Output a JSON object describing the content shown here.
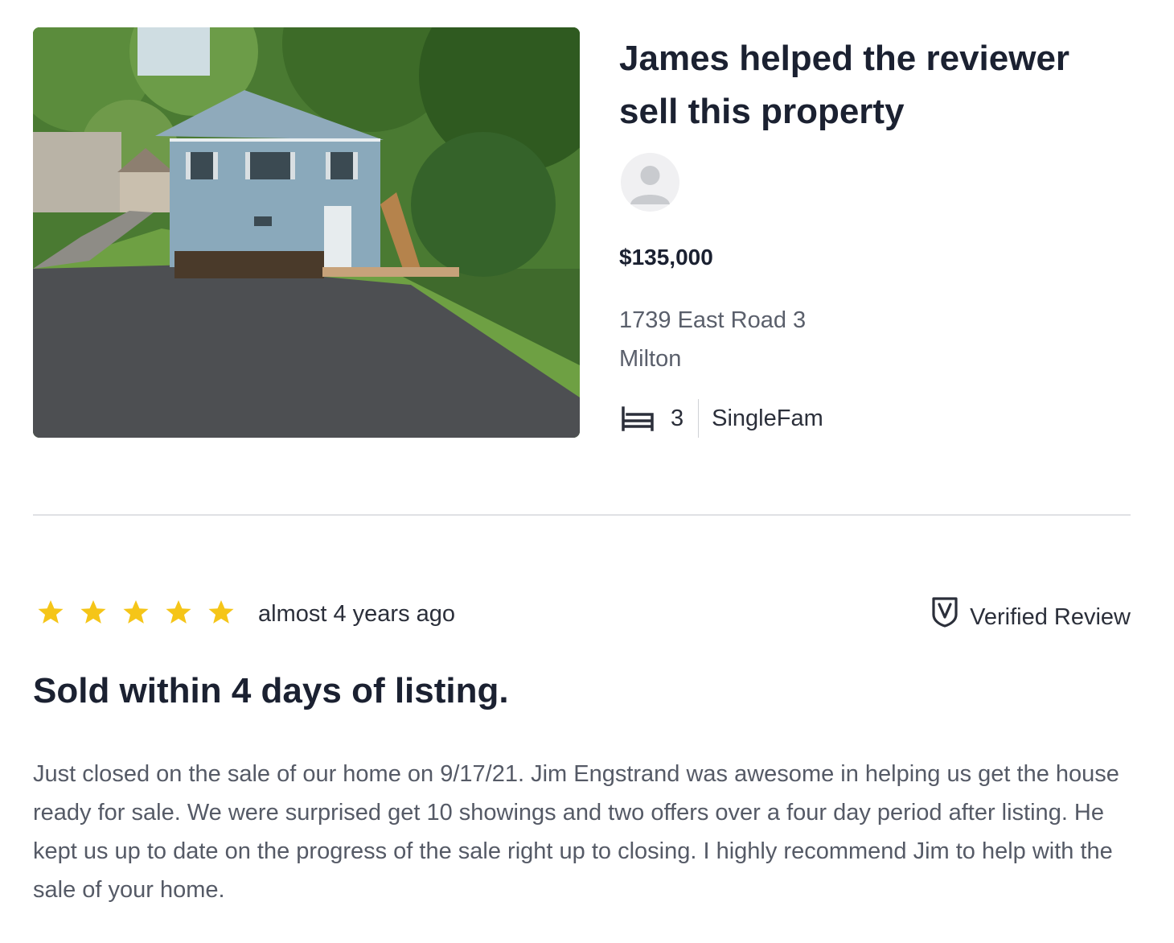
{
  "property": {
    "headline": "James helped the reviewer sell this property",
    "price": "$135,000",
    "address_line1": "1739 East Road 3",
    "address_line2": "Milton",
    "beds": "3",
    "home_type": "SingleFam",
    "photo_icon": "house-photo",
    "avatar_icon": "user-avatar-icon",
    "bed_icon": "bed-icon"
  },
  "review": {
    "rating": 5,
    "rating_max": 5,
    "star_color": "#f5c518",
    "age": "almost 4 years ago",
    "verified_label": "Verified Review",
    "verified_icon": "shield-check-icon",
    "title": "Sold within 4 days of listing.",
    "body": "Just closed on the sale of our home on 9/17/21. Jim Engstrand was awesome in helping us get the house ready for sale. We were surprised get 10 showings and two offers over a four day period after listing. He kept us up to date on the progress of the sale right up to closing. I highly recommend Jim to help with the sale of your home."
  }
}
